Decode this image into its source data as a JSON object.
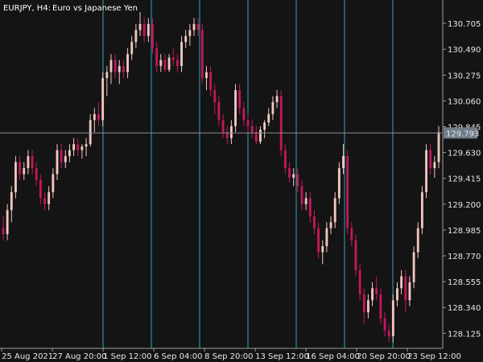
{
  "window": {
    "symbol_timeframe": "EURJPY, H4:",
    "instrument_name": "Euro vs Japanese Yen"
  },
  "colors": {
    "background": "#141414",
    "bull_candle": "#f2c7c2",
    "bear_candle": "#c2185b",
    "period_separator": "#2aa7b3",
    "crosshair": "#8a8f96",
    "axis_line": "#9e9e9e",
    "text": "#e6e6e6",
    "price_tag_bg": "#6f7c8a"
  },
  "chart_data": {
    "type": "candlestick",
    "y_axis_side": "right",
    "ylim": [
      128.0,
      130.9
    ],
    "y_ticks": [
      "130.705",
      "130.490",
      "130.275",
      "130.060",
      "129.845",
      "129.630",
      "129.415",
      "129.200",
      "128.985",
      "128.770",
      "128.555",
      "128.340",
      "128.125"
    ],
    "x_ticks": [
      "25 Aug 2021",
      "27 Aug 20:00",
      "1 Sep 12:00",
      "6 Sep 04:00",
      "8 Sep 20:00",
      "13 Sep 12:00",
      "16 Sep 04:00",
      "20 Sep 20:00",
      "23 Sep 12:00"
    ],
    "current_price": "129.793",
    "grid": false,
    "series": [
      {
        "ohlc": [
          [
            129.0,
            129.1,
            128.9,
            128.95
          ],
          [
            128.95,
            129.2,
            128.9,
            129.15
          ],
          [
            129.15,
            129.35,
            129.05,
            129.3
          ],
          [
            129.3,
            129.6,
            129.25,
            129.55
          ],
          [
            129.55,
            129.6,
            129.4,
            129.45
          ],
          [
            129.45,
            129.55,
            129.4,
            129.5
          ],
          [
            129.5,
            129.65,
            129.45,
            129.6
          ],
          [
            129.6,
            129.65,
            129.45,
            129.5
          ],
          [
            129.5,
            129.55,
            129.35,
            129.4
          ],
          [
            129.4,
            129.45,
            129.2,
            129.25
          ],
          [
            129.25,
            129.3,
            129.15,
            129.2
          ],
          [
            129.2,
            129.35,
            129.15,
            129.3
          ],
          [
            129.3,
            129.5,
            129.25,
            129.45
          ],
          [
            129.45,
            129.7,
            129.4,
            129.65
          ],
          [
            129.65,
            129.7,
            129.5,
            129.55
          ],
          [
            129.55,
            129.65,
            129.5,
            129.6
          ],
          [
            129.6,
            129.7,
            129.55,
            129.65
          ],
          [
            129.65,
            129.75,
            129.6,
            129.7
          ],
          [
            129.7,
            129.75,
            129.6,
            129.65
          ],
          [
            129.65,
            129.7,
            129.58,
            129.68
          ],
          [
            129.68,
            129.75,
            129.6,
            129.7
          ],
          [
            129.7,
            129.95,
            129.68,
            129.9
          ],
          [
            129.9,
            130.0,
            129.8,
            129.95
          ],
          [
            129.95,
            130.05,
            129.85,
            129.9
          ],
          [
            129.9,
            130.3,
            129.85,
            130.25
          ],
          [
            130.25,
            130.35,
            130.1,
            130.3
          ],
          [
            130.3,
            130.45,
            130.2,
            130.4
          ],
          [
            130.4,
            130.45,
            130.25,
            130.3
          ],
          [
            130.3,
            130.4,
            130.2,
            130.35
          ],
          [
            130.35,
            130.4,
            130.25,
            130.3
          ],
          [
            130.3,
            130.5,
            130.25,
            130.45
          ],
          [
            130.45,
            130.6,
            130.4,
            130.55
          ],
          [
            130.55,
            130.7,
            130.5,
            130.65
          ],
          [
            130.65,
            130.8,
            130.6,
            130.7
          ],
          [
            130.7,
            130.75,
            130.55,
            130.6
          ],
          [
            130.6,
            130.75,
            130.55,
            130.7
          ],
          [
            130.7,
            130.75,
            130.45,
            130.5
          ],
          [
            130.5,
            130.55,
            130.3,
            130.35
          ],
          [
            130.35,
            130.45,
            130.3,
            130.4
          ],
          [
            130.4,
            130.45,
            130.3,
            130.32
          ],
          [
            130.32,
            130.45,
            130.3,
            130.42
          ],
          [
            130.42,
            130.5,
            130.35,
            130.4
          ],
          [
            130.4,
            130.45,
            130.3,
            130.35
          ],
          [
            130.35,
            130.6,
            130.3,
            130.55
          ],
          [
            130.55,
            130.65,
            130.5,
            130.6
          ],
          [
            130.6,
            130.7,
            130.52,
            130.65
          ],
          [
            130.65,
            130.75,
            130.6,
            130.7
          ],
          [
            130.7,
            130.75,
            130.6,
            130.65
          ],
          [
            130.65,
            130.7,
            130.2,
            130.25
          ],
          [
            130.25,
            130.35,
            130.15,
            130.3
          ],
          [
            130.3,
            130.35,
            130.1,
            130.15
          ],
          [
            130.15,
            130.2,
            129.95,
            130.05
          ],
          [
            130.05,
            130.1,
            129.85,
            129.9
          ],
          [
            129.9,
            129.95,
            129.75,
            129.8
          ],
          [
            129.8,
            129.85,
            129.7,
            129.75
          ],
          [
            129.75,
            129.9,
            129.7,
            129.85
          ],
          [
            129.85,
            130.2,
            129.8,
            130.15
          ],
          [
            130.15,
            130.2,
            129.95,
            130.0
          ],
          [
            130.0,
            130.05,
            129.85,
            129.9
          ],
          [
            129.9,
            129.95,
            129.8,
            129.85
          ],
          [
            129.85,
            129.9,
            129.75,
            129.8
          ],
          [
            129.8,
            129.85,
            129.7,
            129.72
          ],
          [
            129.72,
            129.85,
            129.7,
            129.82
          ],
          [
            129.82,
            129.9,
            129.75,
            129.88
          ],
          [
            129.88,
            130.0,
            129.85,
            129.95
          ],
          [
            129.95,
            130.1,
            129.9,
            130.05
          ],
          [
            130.05,
            130.15,
            130.0,
            130.1
          ],
          [
            130.1,
            130.15,
            129.6,
            129.65
          ],
          [
            129.65,
            129.7,
            129.45,
            129.5
          ],
          [
            129.5,
            129.55,
            129.38,
            129.42
          ],
          [
            129.42,
            129.5,
            129.35,
            129.45
          ],
          [
            129.45,
            129.5,
            129.3,
            129.35
          ],
          [
            129.35,
            129.4,
            129.15,
            129.2
          ],
          [
            129.2,
            129.3,
            129.15,
            129.25
          ],
          [
            129.25,
            129.3,
            129.05,
            129.1
          ],
          [
            129.1,
            129.15,
            128.95,
            129.0
          ],
          [
            129.0,
            129.05,
            128.75,
            128.8
          ],
          [
            128.8,
            128.9,
            128.7,
            128.85
          ],
          [
            128.85,
            129.05,
            128.8,
            129.0
          ],
          [
            129.0,
            129.1,
            128.95,
            129.05
          ],
          [
            129.05,
            129.3,
            129.0,
            129.25
          ],
          [
            129.25,
            129.55,
            129.2,
            129.5
          ],
          [
            129.5,
            129.7,
            129.45,
            129.6
          ],
          [
            129.6,
            129.65,
            128.95,
            129.0
          ],
          [
            129.0,
            129.05,
            128.85,
            128.9
          ],
          [
            128.9,
            128.95,
            128.6,
            128.65
          ],
          [
            128.65,
            128.7,
            128.4,
            128.45
          ],
          [
            128.45,
            128.5,
            128.2,
            128.3
          ],
          [
            128.3,
            128.45,
            128.25,
            128.4
          ],
          [
            128.4,
            128.55,
            128.35,
            128.5
          ],
          [
            128.5,
            128.6,
            128.4,
            128.45
          ],
          [
            128.45,
            128.5,
            128.2,
            128.25
          ],
          [
            128.25,
            128.3,
            128.1,
            128.15
          ],
          [
            128.15,
            128.2,
            128.05,
            128.1
          ],
          [
            128.1,
            128.45,
            128.05,
            128.4
          ],
          [
            128.4,
            128.55,
            128.35,
            128.5
          ],
          [
            128.5,
            128.65,
            128.45,
            128.6
          ],
          [
            128.6,
            128.65,
            128.3,
            128.4
          ],
          [
            128.4,
            128.6,
            128.35,
            128.55
          ],
          [
            128.55,
            128.85,
            128.5,
            128.8
          ],
          [
            128.8,
            129.05,
            128.75,
            129.0
          ],
          [
            129.0,
            129.35,
            128.95,
            129.3
          ],
          [
            129.3,
            129.7,
            129.25,
            129.65
          ],
          [
            129.65,
            129.7,
            129.45,
            129.5
          ],
          [
            129.5,
            129.6,
            129.42,
            129.55
          ],
          [
            129.55,
            129.85,
            129.5,
            129.8
          ]
        ]
      }
    ]
  }
}
